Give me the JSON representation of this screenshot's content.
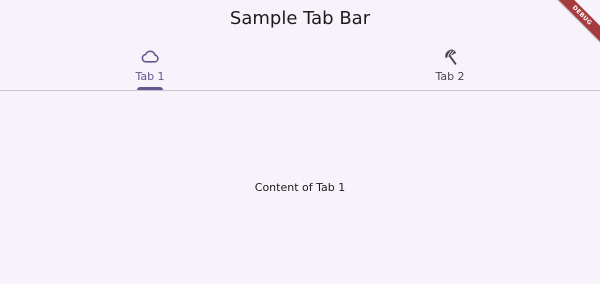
{
  "app_bar": {
    "title": "Sample Tab Bar"
  },
  "tabs": [
    {
      "label": "Tab 1",
      "icon": "cloud-icon",
      "active": true
    },
    {
      "label": "Tab 2",
      "icon": "beach-umbrella-icon",
      "active": false
    }
  ],
  "content": {
    "text": "Content of Tab 1"
  },
  "debug_banner": {
    "label": "DEBUG"
  },
  "colors": {
    "background": "#f8f2fa",
    "accent": "#65558f",
    "divider": "#cac4d0",
    "debug_banner": "#a63a3d"
  }
}
